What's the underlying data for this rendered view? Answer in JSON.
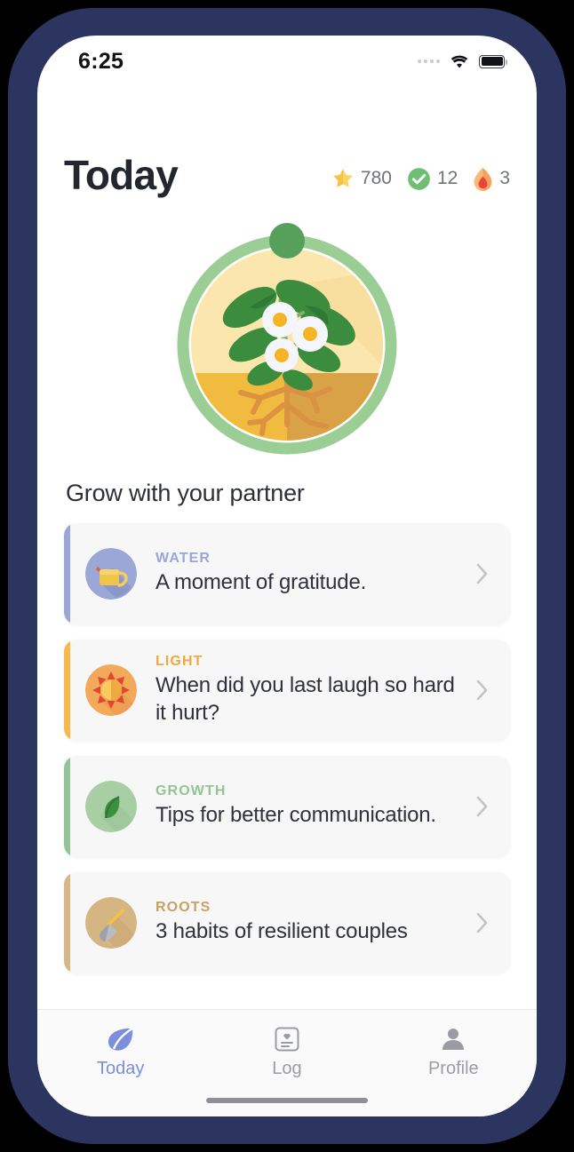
{
  "statusbar": {
    "time": "6:25",
    "signal_icon": "signal-dots-icon",
    "wifi_icon": "wifi-icon",
    "battery_icon": "battery-full-icon"
  },
  "header": {
    "title": "Today",
    "stats": [
      {
        "icon": "star-icon",
        "value": "780",
        "color": "#f9c440"
      },
      {
        "icon": "check-circle-icon",
        "value": "12",
        "color": "#6fbf73"
      },
      {
        "icon": "flame-icon",
        "value": "3",
        "color": "#f07f3c"
      }
    ]
  },
  "hero": {
    "name": "plant-growth-illustration",
    "ring_color": "#9bce94",
    "sky_color": "#fbe6ad",
    "soil_color": "#efb53d",
    "marker_color": "#57a05c"
  },
  "section": {
    "title": "Grow with your partner"
  },
  "cards": [
    {
      "label": "WATER",
      "text": "A moment of gratitude.",
      "accent": "#9aa6d8",
      "label_color": "#9aa6d8",
      "icon": "watering-can-icon",
      "icon_bg": "#9ba7d4"
    },
    {
      "label": "LIGHT",
      "text": "When did you last laugh so hard it hurt?",
      "accent": "#f5b94f",
      "label_color": "#f0aa3c",
      "icon": "sun-icon",
      "icon_bg": "#f3a95a"
    },
    {
      "label": "GROWTH",
      "text": "Tips for better communication.",
      "accent": "#93c495",
      "label_color": "#93c495",
      "icon": "leaf-icon",
      "icon_bg": "#a7cfa3"
    },
    {
      "label": "ROOTS",
      "text": "3 habits of resilient couples",
      "accent": "#d6b788",
      "label_color": "#c9a262",
      "icon": "shovel-icon",
      "icon_bg": "#d5b582"
    }
  ],
  "tabbar": {
    "tabs": [
      {
        "label": "Today",
        "icon": "leaf-icon",
        "active": true
      },
      {
        "label": "Log",
        "icon": "journal-heart-icon",
        "active": false
      },
      {
        "label": "Profile",
        "icon": "person-icon",
        "active": false
      }
    ],
    "active_color": "#7b8fdb",
    "inactive_color": "#9a9ca2"
  }
}
